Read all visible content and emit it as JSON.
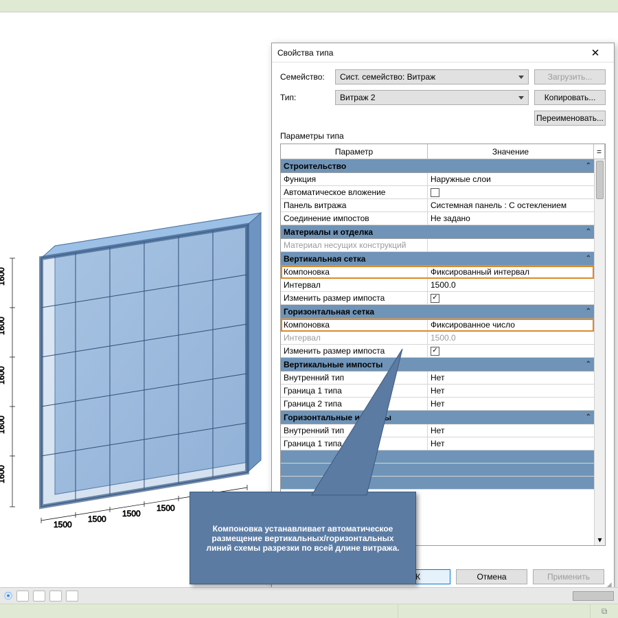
{
  "dialog": {
    "title": "Свойства типа",
    "family_label": "Семейство:",
    "type_label": "Тип:",
    "family_value": "Сист. семейство: Витраж",
    "type_value": "Витраж 2",
    "load_btn": "Загрузить...",
    "copy_btn": "Копировать...",
    "rename_btn": "Переименовать...",
    "params_label": "Параметры типа",
    "col_param": "Параметр",
    "col_value": "Значение",
    "ok": "ОК",
    "cancel": "Отмена",
    "apply": "Применить",
    "col_eq": "="
  },
  "groups": [
    {
      "header": "Строительство",
      "rows": [
        {
          "p": "Функция",
          "v": "Наружные слои"
        },
        {
          "p": "Автоматическое вложение",
          "v": "chk-off"
        },
        {
          "p": "Панель витража",
          "v": "Системная панель : С остеклением"
        },
        {
          "p": "Соединение импостов",
          "v": "Не задано"
        }
      ]
    },
    {
      "header": "Материалы и отделка",
      "rows": [
        {
          "p": "Материал несущих конструкций",
          "v": "",
          "dim": true
        }
      ]
    },
    {
      "header": "Вертикальная сетка",
      "rows": [
        {
          "p": "Компоновка",
          "v": "Фиксированный интервал",
          "hl": true
        },
        {
          "p": "Интервал",
          "v": "1500.0"
        },
        {
          "p": "Изменить размер импоста",
          "v": "chk-on"
        }
      ]
    },
    {
      "header": "Горизонтальная сетка",
      "rows": [
        {
          "p": "Компоновка",
          "v": "Фиксированное число",
          "hl": true
        },
        {
          "p": "Интервал",
          "v": "1500.0",
          "dim": true
        },
        {
          "p": "Изменить размер импоста",
          "v": "chk-on"
        }
      ]
    },
    {
      "header": "Вертикальные импосты",
      "rows": [
        {
          "p": "Внутренний тип",
          "v": "Нет"
        },
        {
          "p": "Граница 1 типа",
          "v": "Нет"
        },
        {
          "p": "Граница 2 типа",
          "v": "Нет"
        }
      ]
    },
    {
      "header": "Горизонтальные импосты",
      "rows": [
        {
          "p": "Внутренний тип",
          "v": "Нет"
        },
        {
          "p": "Граница 1 типа",
          "v": "Нет"
        }
      ]
    }
  ],
  "callout": "Компоновка устанавливает автоматическое размещение вертикальных/горизонтальных линий схемы разрезки по всей длине витража.",
  "dims": {
    "h": "1500",
    "v": "1600"
  }
}
